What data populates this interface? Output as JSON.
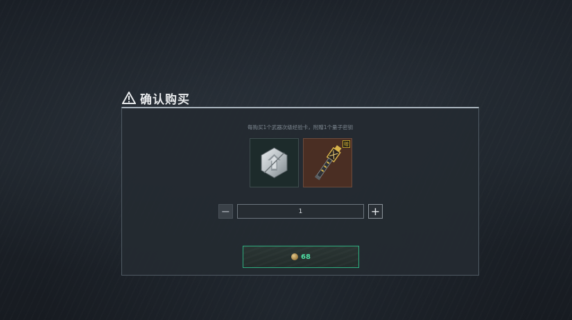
{
  "dialog": {
    "title": "确认购买",
    "description": "每购买1个武器次级经验卡，附赠1个量子密钥",
    "items": [
      {
        "name": "weapon-upgrade-card",
        "icon": "upgrade-badge-icon",
        "gift": false
      },
      {
        "name": "quantum-key",
        "icon": "quantum-key-icon",
        "gift": true,
        "badge": "赠"
      }
    ],
    "quantity": {
      "value": "1",
      "minus_label": "−",
      "plus_label": "+"
    },
    "purchase": {
      "currency_icon": "coin-icon",
      "price": "68"
    }
  },
  "colors": {
    "accent": "#2fae7f",
    "price_text": "#4fe0a4",
    "gift_badge": "#e0b93a"
  }
}
